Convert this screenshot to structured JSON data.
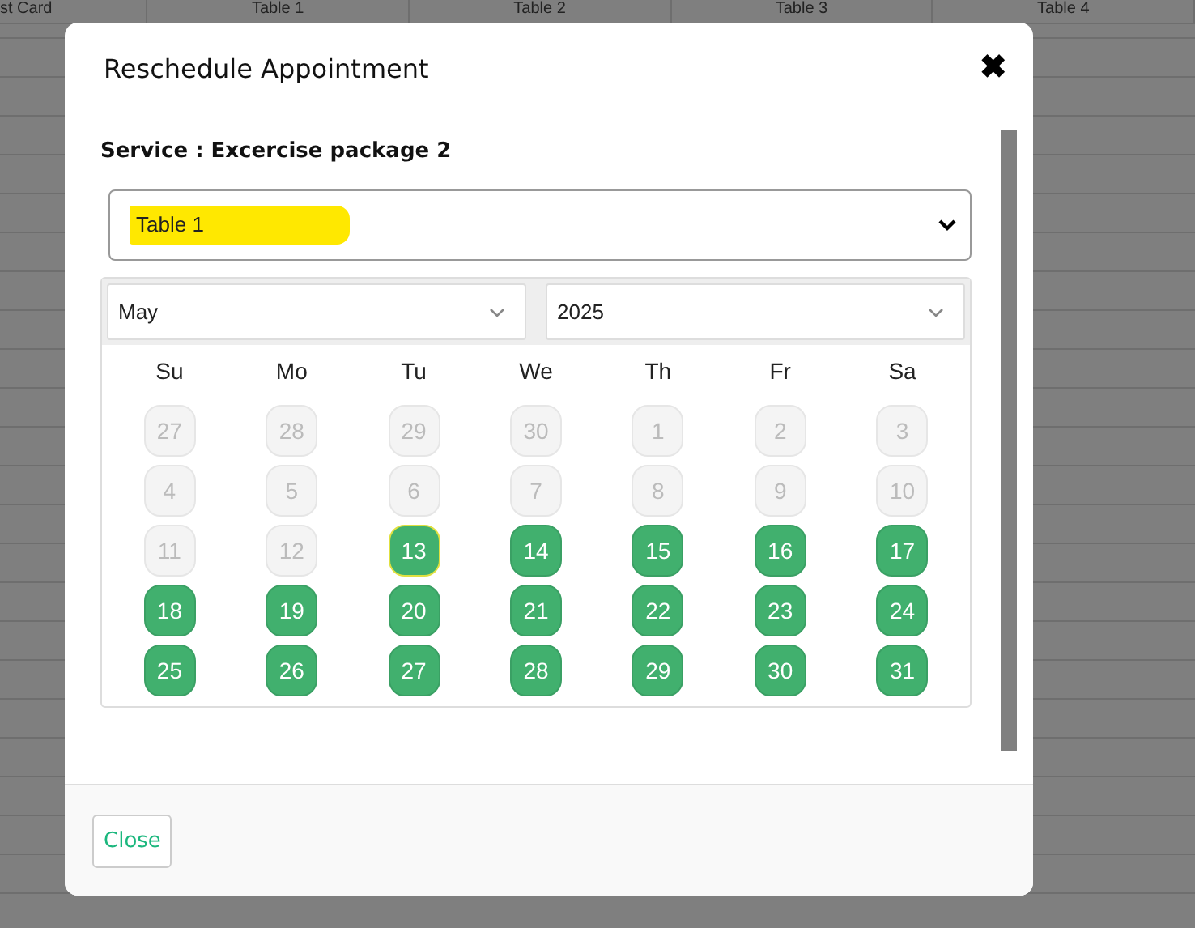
{
  "background_table": {
    "columns": [
      "st Card",
      "Table 1",
      "Table 2",
      "Table 3",
      "Table 4"
    ]
  },
  "dialog": {
    "title": "Reschedule Appointment",
    "close_icon": "✖",
    "service_label": "Service : Excercise package 2",
    "table_select": {
      "value": "Table 1",
      "highlighted": true
    },
    "calendar": {
      "month": "May",
      "year": "2025",
      "weekdays": [
        "Su",
        "Mo",
        "Tu",
        "We",
        "Th",
        "Fr",
        "Sa"
      ],
      "days": [
        {
          "label": "27",
          "available": false,
          "today": false
        },
        {
          "label": "28",
          "available": false,
          "today": false
        },
        {
          "label": "29",
          "available": false,
          "today": false
        },
        {
          "label": "30",
          "available": false,
          "today": false
        },
        {
          "label": "1",
          "available": false,
          "today": false
        },
        {
          "label": "2",
          "available": false,
          "today": false
        },
        {
          "label": "3",
          "available": false,
          "today": false
        },
        {
          "label": "4",
          "available": false,
          "today": false
        },
        {
          "label": "5",
          "available": false,
          "today": false
        },
        {
          "label": "6",
          "available": false,
          "today": false
        },
        {
          "label": "7",
          "available": false,
          "today": false
        },
        {
          "label": "8",
          "available": false,
          "today": false
        },
        {
          "label": "9",
          "available": false,
          "today": false
        },
        {
          "label": "10",
          "available": false,
          "today": false
        },
        {
          "label": "11",
          "available": false,
          "today": false
        },
        {
          "label": "12",
          "available": false,
          "today": false
        },
        {
          "label": "13",
          "available": true,
          "today": true
        },
        {
          "label": "14",
          "available": true,
          "today": false
        },
        {
          "label": "15",
          "available": true,
          "today": false
        },
        {
          "label": "16",
          "available": true,
          "today": false
        },
        {
          "label": "17",
          "available": true,
          "today": false
        },
        {
          "label": "18",
          "available": true,
          "today": false
        },
        {
          "label": "19",
          "available": true,
          "today": false
        },
        {
          "label": "20",
          "available": true,
          "today": false
        },
        {
          "label": "21",
          "available": true,
          "today": false
        },
        {
          "label": "22",
          "available": true,
          "today": false
        },
        {
          "label": "23",
          "available": true,
          "today": false
        },
        {
          "label": "24",
          "available": true,
          "today": false
        },
        {
          "label": "25",
          "available": true,
          "today": false
        },
        {
          "label": "26",
          "available": true,
          "today": false
        },
        {
          "label": "27",
          "available": true,
          "today": false
        },
        {
          "label": "28",
          "available": true,
          "today": false
        },
        {
          "label": "29",
          "available": true,
          "today": false
        },
        {
          "label": "30",
          "available": true,
          "today": false
        },
        {
          "label": "31",
          "available": true,
          "today": false
        }
      ]
    },
    "footer_button": "Close"
  }
}
